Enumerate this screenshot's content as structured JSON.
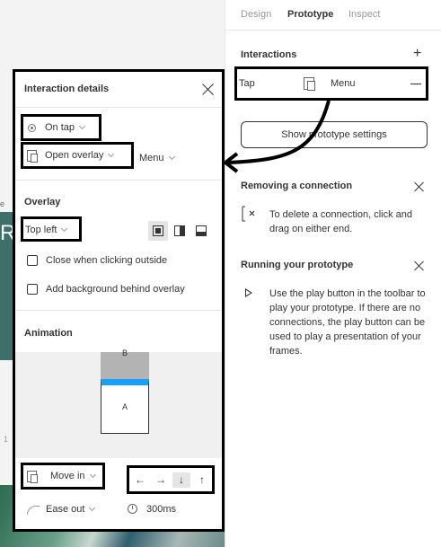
{
  "tabs": [
    {
      "label": "Design",
      "active": false
    },
    {
      "label": "Prototype",
      "active": true
    },
    {
      "label": "Inspect",
      "active": false
    }
  ],
  "interactions": {
    "title": "Interactions",
    "add_icon": "plus-icon",
    "row": {
      "trigger": "Tap",
      "destination": "Menu",
      "remove_icon": "minus-icon"
    }
  },
  "show_settings_label": "Show prototype settings",
  "removing": {
    "title": "Removing a connection",
    "text": "To delete a connection, click and drag on either end."
  },
  "running": {
    "title": "Running your prototype",
    "text": "Use the play button in the toolbar to play your prototype. If there are no connections, the play button can be used to play a presentation of your frames."
  },
  "details": {
    "title": "Interaction details",
    "trigger": "On tap",
    "action": "Open overlay",
    "destination": "Menu",
    "overlay_section": "Overlay",
    "position": "Top left",
    "close_outside_label": "Close when clicking outside",
    "add_background_label": "Add background behind overlay",
    "animation_section": "Animation",
    "preview": {
      "top_label": "B",
      "bottom_label": "A"
    },
    "animation_type": "Move in",
    "directions": [
      "←",
      "→",
      "↓",
      "↑"
    ],
    "active_direction": "↓",
    "easing": "Ease out",
    "duration": "300ms"
  },
  "canvas": {
    "frame_letter": "R",
    "label_1": "e",
    "label_2": "1"
  },
  "colors": {
    "accent": "#18a0fb",
    "highlight_border": "#000000"
  }
}
